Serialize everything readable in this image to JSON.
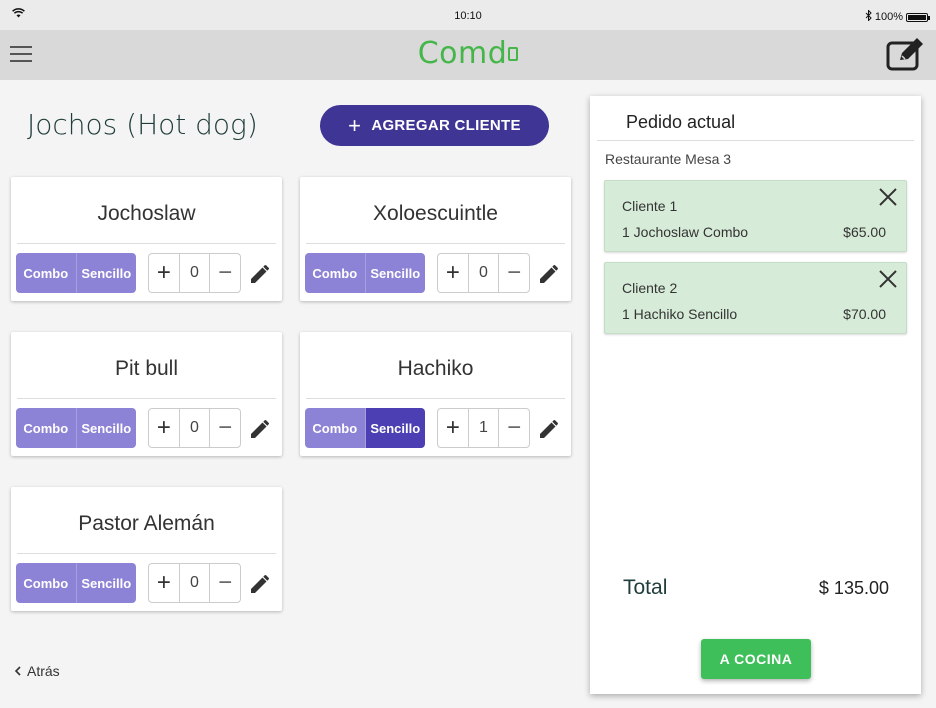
{
  "status_bar": {
    "time": "10:10",
    "battery": "100%",
    "icons": [
      "wifi-icon",
      "bluetooth-icon",
      "battery-icon"
    ]
  },
  "app_bar": {
    "logo": "Comd",
    "menu_icon": "hamburger-menu-icon",
    "edit_icon": "edit-note-icon"
  },
  "main": {
    "title": "Jochos (Hot dog)",
    "add_client_label": "AGREGAR CLIENTE",
    "products": [
      {
        "name": "Jochoslaw",
        "combo_label": "Combo",
        "sencillo_label": "Sencillo",
        "selected": "none",
        "qty": "0"
      },
      {
        "name": "Xoloescuintle",
        "combo_label": "Combo",
        "sencillo_label": "Sencillo",
        "selected": "none",
        "qty": "0"
      },
      {
        "name": "Pit bull",
        "combo_label": "Combo",
        "sencillo_label": "Sencillo",
        "selected": "none",
        "qty": "0"
      },
      {
        "name": "Hachiko",
        "combo_label": "Combo",
        "sencillo_label": "Sencillo",
        "selected": "Sencillo",
        "qty": "1"
      },
      {
        "name": "Pastor Alemán",
        "combo_label": "Combo",
        "sencillo_label": "Sencillo",
        "selected": "none",
        "qty": "0"
      }
    ],
    "back_label": "Atrás"
  },
  "order": {
    "title": "Pedido actual",
    "subtitle": "Restaurante Mesa 3",
    "clients": [
      {
        "name": "Cliente 1",
        "item": "1 Jochoslaw Combo",
        "price": "$65.00"
      },
      {
        "name": "Cliente 2",
        "item": "1 Hachiko Sencillo",
        "price": "$70.00"
      }
    ],
    "total_label": "Total",
    "total_value": "$ 135.00",
    "submit_label": "A COCINA"
  },
  "colors": {
    "brand_green": "#45b649",
    "primary_purple": "#3f3594",
    "segment_light": "#8d83d6",
    "segment_active": "#4b3fb3",
    "client_box": "#d7ecd8",
    "kitchen_button": "#3fbf5a"
  }
}
